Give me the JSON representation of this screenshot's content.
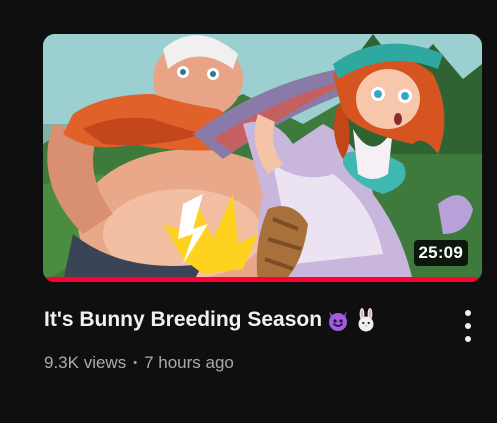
{
  "video": {
    "title": "It's Bunny Breeding Season",
    "title_emojis": [
      "smiling-devil-emoji",
      "rabbit-emoji"
    ],
    "duration": "25:09",
    "views": "9.3K views",
    "separator": "•",
    "uploaded": "7 hours ago",
    "watch_progress": 1.0,
    "progress_color": "#ff0033"
  },
  "colors": {
    "background": "#0f0f0f",
    "title_text": "#f1f1f1",
    "meta_text": "#aaaaaa"
  },
  "icons": {
    "menu": "more-vertical-icon"
  }
}
